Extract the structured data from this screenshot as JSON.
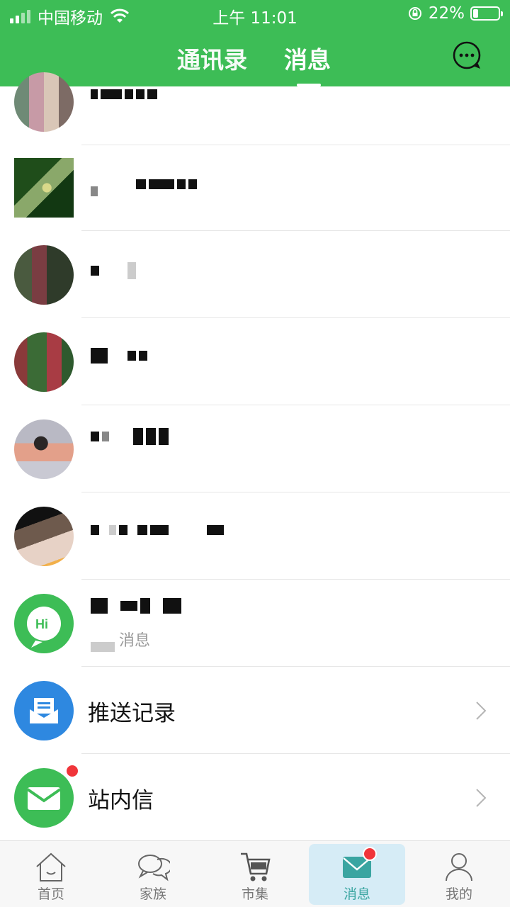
{
  "status_bar": {
    "carrier": "中国移动",
    "time": "上午 11:01",
    "battery_percent": "22%",
    "battery_level": 0.22
  },
  "header": {
    "tabs": [
      "通讯录",
      "消息"
    ],
    "active_tab": "消息",
    "header_color": "#3dbd56",
    "action_icon": "chat-bubble-icon"
  },
  "conversations": [
    {
      "id": 1,
      "redacted": true
    },
    {
      "id": 2,
      "redacted": true
    },
    {
      "id": 3,
      "redacted": true
    },
    {
      "id": 4,
      "redacted": true
    },
    {
      "id": 5,
      "redacted": true
    },
    {
      "id": 6,
      "redacted": true
    },
    {
      "id": 7,
      "redacted": true,
      "subtitle": "消息"
    }
  ],
  "system_items": [
    {
      "label": "推送记录",
      "icon": "inbox-icon",
      "color": "#2e88e0"
    },
    {
      "label": "站内信",
      "icon": "envelope-icon",
      "color": "#3dbd56",
      "has_badge": true
    }
  ],
  "bottom_nav": [
    {
      "label": "首页",
      "icon": "home-icon"
    },
    {
      "label": "家族",
      "icon": "chat-icon"
    },
    {
      "label": "市集",
      "icon": "cart-icon"
    },
    {
      "label": "消息",
      "icon": "mail-icon",
      "active": true,
      "has_badge": true
    },
    {
      "label": "我的",
      "icon": "user-icon"
    }
  ]
}
